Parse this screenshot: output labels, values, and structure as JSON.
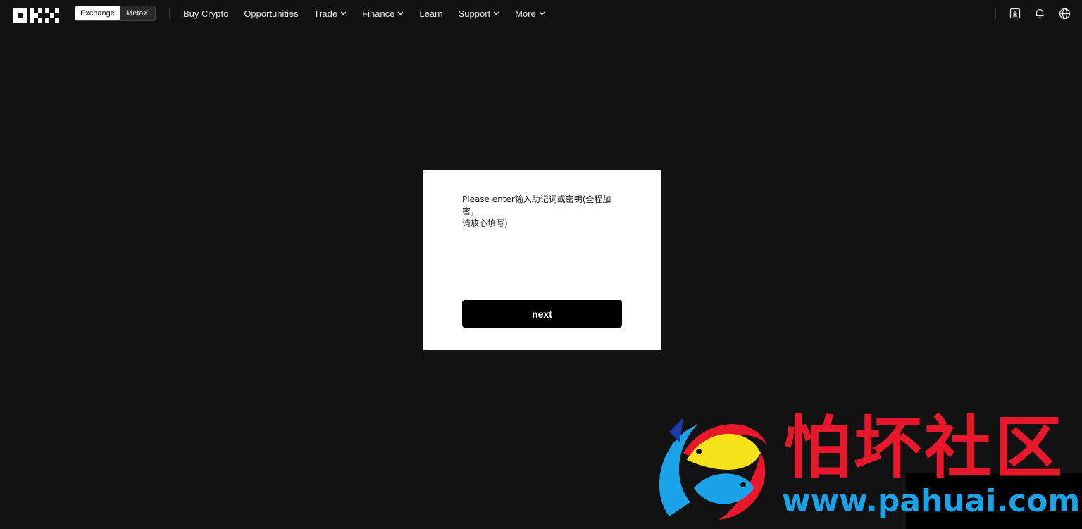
{
  "nav": {
    "logo_icon": "okx-logo",
    "switch": {
      "exchange": "Exchange",
      "metax": "MetaX"
    },
    "items": [
      {
        "label": "Buy Crypto",
        "dropdown": false
      },
      {
        "label": "Opportunities",
        "dropdown": false
      },
      {
        "label": "Trade",
        "dropdown": true
      },
      {
        "label": "Finance",
        "dropdown": true
      },
      {
        "label": "Learn",
        "dropdown": false
      },
      {
        "label": "Support",
        "dropdown": true
      },
      {
        "label": "More",
        "dropdown": true
      }
    ],
    "right_icons": [
      "download-icon",
      "bell-icon",
      "globe-icon"
    ]
  },
  "dialog": {
    "prompt_line1": "Please enter输入助记词或密钥(全程加密，",
    "prompt_line2": "请放心填写)",
    "input_value": "",
    "next_label": "next"
  },
  "watermark": {
    "brand_cn": "怕坏社区",
    "url": "www.pahuai.com",
    "colors": {
      "red": "#e8172c",
      "blue": "#1aa3e8",
      "yellow": "#f5e21a"
    }
  },
  "colors": {
    "background": "#121212",
    "card": "#ffffff",
    "button": "#000000"
  }
}
